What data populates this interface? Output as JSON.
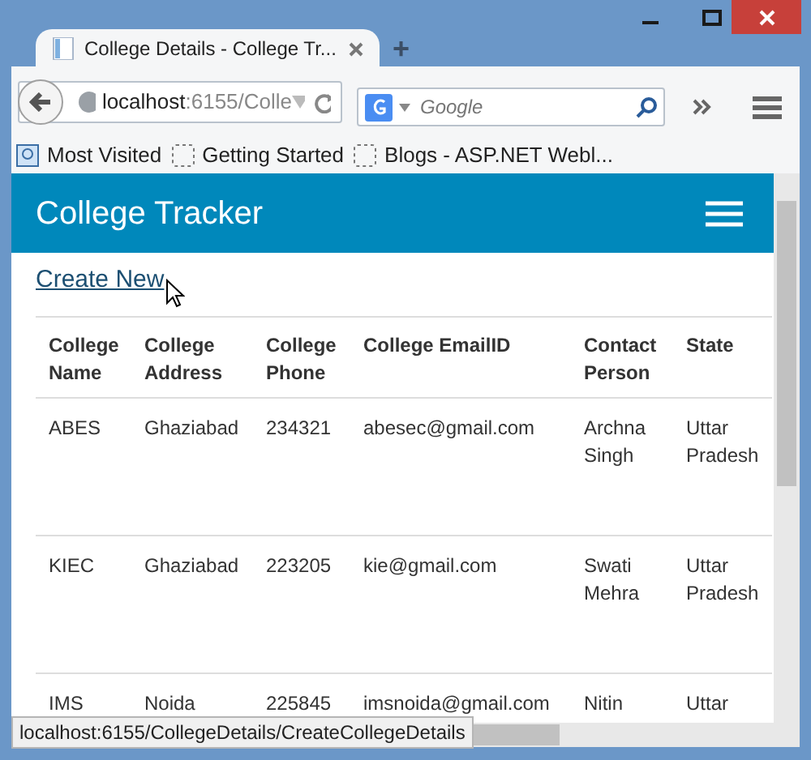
{
  "window": {
    "tab_title": "College Details - College Tr...",
    "new_tab": "+"
  },
  "navigation": {
    "address_host": "localhost",
    "address_path": ":6155/Colle",
    "search_placeholder": "Google"
  },
  "bookmarks": [
    {
      "label": "Most Visited",
      "kind": "special"
    },
    {
      "label": "Getting Started",
      "kind": "page"
    },
    {
      "label": "Blogs - ASP.NET Webl...",
      "kind": "page"
    }
  ],
  "site": {
    "brand": "College Tracker",
    "create_link": "Create New"
  },
  "table": {
    "columns": [
      "College Name",
      "College Address",
      "College Phone",
      "College EmailID",
      "Contact Person",
      "State"
    ],
    "rows": [
      [
        "ABES",
        "Ghaziabad",
        "234321",
        "abesec@gmail.com",
        "Archna Singh",
        "Uttar Pradesh"
      ],
      [
        "KIEC",
        "Ghaziabad",
        "223205",
        "kie@gmail.com",
        "Swati Mehra",
        "Uttar Pradesh"
      ],
      [
        "IMS",
        "Noida",
        "225845",
        "imsnoida@gmail.com",
        "Nitin",
        "Uttar"
      ]
    ]
  },
  "status_bar": "localhost:6155/CollegeDetails/CreateCollegeDetails"
}
